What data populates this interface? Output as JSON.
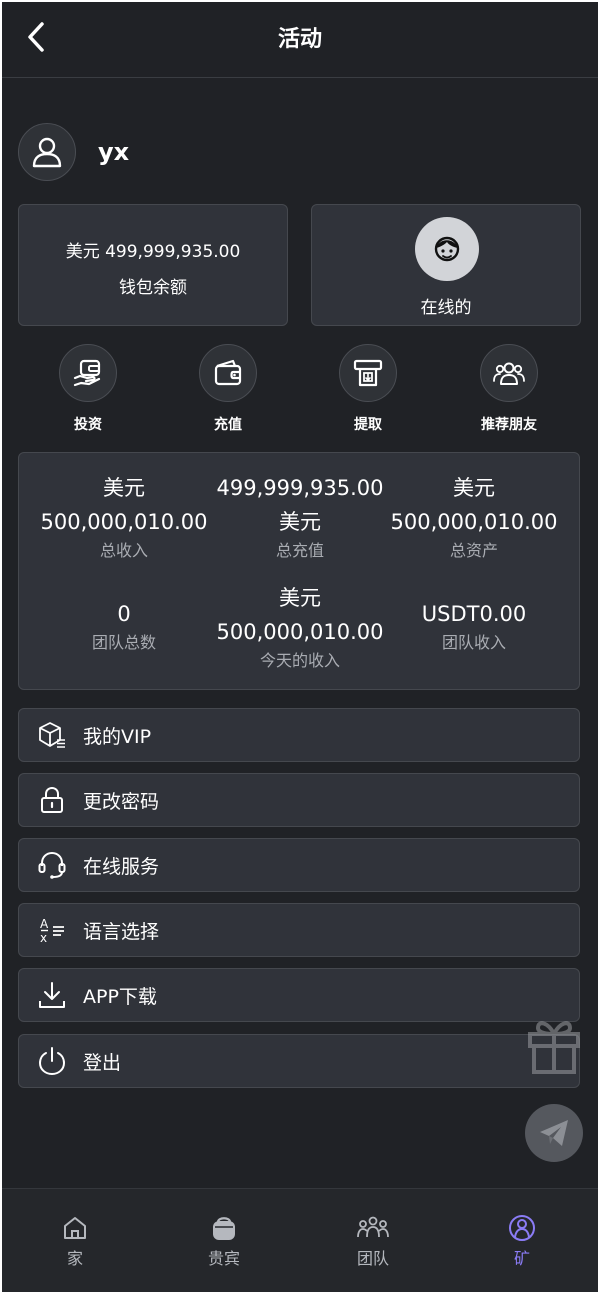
{
  "header": {
    "title": "活动"
  },
  "user": {
    "name": "yx"
  },
  "wallet": {
    "amount": "美元 499,999,935.00",
    "label": "钱包余额"
  },
  "online": {
    "label": "在线的"
  },
  "actions": [
    {
      "label": "投资",
      "icon": "invest-icon"
    },
    {
      "label": "充值",
      "icon": "wallet-icon"
    },
    {
      "label": "提取",
      "icon": "atm-withdraw-icon"
    },
    {
      "label": "推荐朋友",
      "icon": "group-users-icon"
    }
  ],
  "stats": {
    "total_income": {
      "line1": "美元",
      "line2": "500,000,010.00",
      "label": "总收入"
    },
    "total_recharge": {
      "line1": "499,999,935.00",
      "line2": "美元",
      "label": "总充值"
    },
    "total_assets": {
      "line1": "美元",
      "line2": "500,000,010.00",
      "label": "总资产"
    },
    "team_total": {
      "value": "0",
      "label": "团队总数"
    },
    "today_income": {
      "line1": "美元",
      "line2": "500,000,010.00",
      "label": "今天的收入"
    },
    "team_income": {
      "value": "USDT0.00",
      "label": "团队收入"
    }
  },
  "menu": [
    {
      "label": "我的VIP",
      "icon": "vip-box-icon"
    },
    {
      "label": "更改密码",
      "icon": "lock-icon"
    },
    {
      "label": "在线服务",
      "icon": "headset-icon"
    },
    {
      "label": "语言选择",
      "icon": "translate-icon"
    },
    {
      "label": "APP下载",
      "icon": "download-icon"
    },
    {
      "label": "登出",
      "icon": "power-icon"
    }
  ],
  "tabs": [
    {
      "label": "家",
      "icon": "home-icon",
      "active": false
    },
    {
      "label": "贵宾",
      "icon": "basket-icon",
      "active": false
    },
    {
      "label": "团队",
      "icon": "team-icon",
      "active": false
    },
    {
      "label": "矿",
      "icon": "person-circle-icon",
      "active": true
    }
  ],
  "colors": {
    "background": "#202226",
    "card": "#30333a",
    "accent": "#8b7cf6",
    "muted_text": "#a9acb2"
  }
}
